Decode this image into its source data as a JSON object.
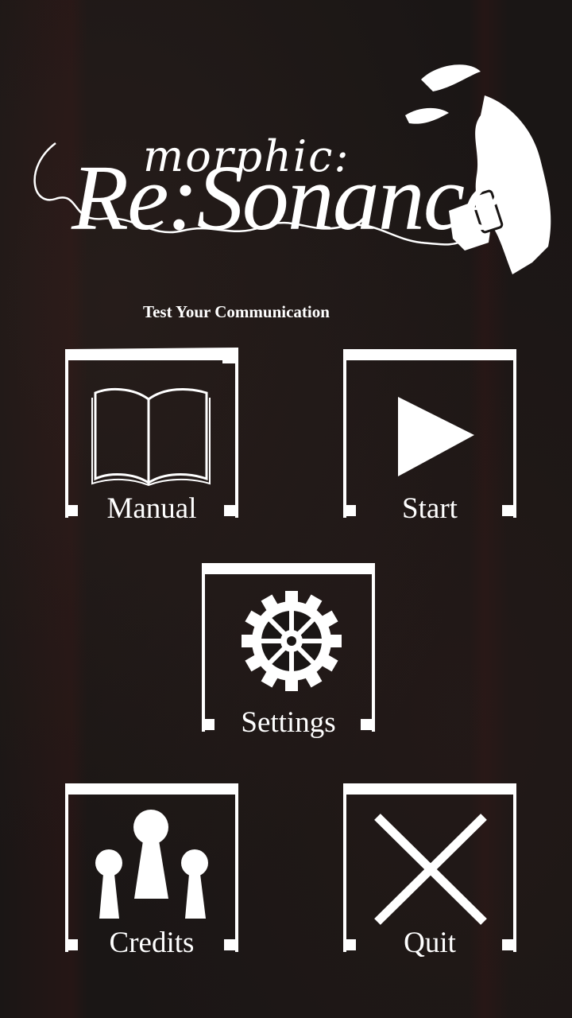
{
  "logo": {
    "title_top": "morphic:",
    "title_main": "Re:Sonance",
    "tagline": "Test Your Communication"
  },
  "menu": {
    "manual": "Manual",
    "start": "Start",
    "settings": "Settings",
    "credits": "Credits",
    "quit": "Quit"
  },
  "icons": {
    "manual": "book-icon",
    "start": "play-icon",
    "settings": "gear-icon",
    "credits": "people-icon",
    "quit": "close-icon"
  },
  "colors": {
    "background": "#1a1615",
    "foreground": "#ffffff"
  }
}
